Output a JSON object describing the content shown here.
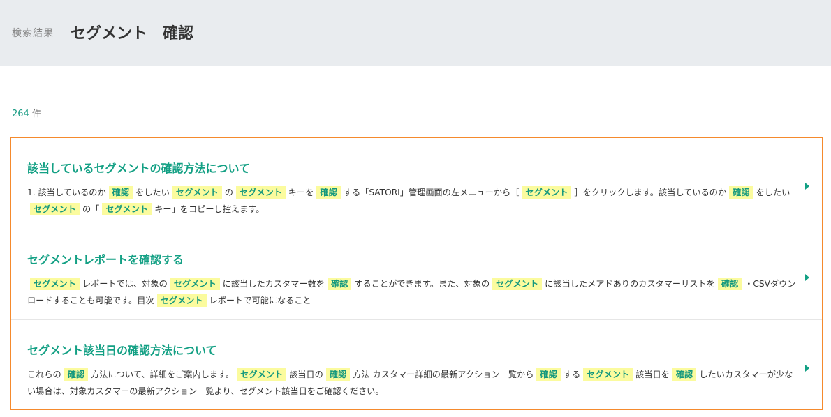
{
  "header": {
    "label": "検索結果",
    "query": "セグメント　確認"
  },
  "result_count": {
    "number": "264",
    "unit": "件"
  },
  "results": [
    {
      "title": "該当しているセグメントの確認方法について",
      "snippet": [
        {
          "t": "1. 該当しているのか"
        },
        {
          "t": "確認",
          "hl": true
        },
        {
          "t": "をしたい"
        },
        {
          "t": "セグメント",
          "hl": true
        },
        {
          "t": "の"
        },
        {
          "t": "セグメント",
          "hl": true
        },
        {
          "t": "キーを"
        },
        {
          "t": "確認",
          "hl": true
        },
        {
          "t": "する「SATORI」管理画面の左メニューから［"
        },
        {
          "t": "セグメント",
          "hl": true
        },
        {
          "t": "］をクリックします。該当しているのか"
        },
        {
          "t": "確認",
          "hl": true
        },
        {
          "t": "をしたい"
        },
        {
          "t": "セグメント",
          "hl": true
        },
        {
          "t": "の「"
        },
        {
          "t": "セグメント",
          "hl": true
        },
        {
          "t": "キー」をコピーし控えます。"
        }
      ]
    },
    {
      "title": "セグメントレポートを確認する",
      "snippet": [
        {
          "t": "セグメント",
          "hl": true
        },
        {
          "t": "レポートでは、対象の"
        },
        {
          "t": "セグメント",
          "hl": true
        },
        {
          "t": "に該当したカスタマー数を"
        },
        {
          "t": "確認",
          "hl": true
        },
        {
          "t": "することができます。また、対象の"
        },
        {
          "t": "セグメント",
          "hl": true
        },
        {
          "t": "に該当したメアドありのカスタマーリストを"
        },
        {
          "t": "確認",
          "hl": true
        },
        {
          "t": "・CSVダウンロードすることも可能です。目次"
        },
        {
          "t": "セグメント",
          "hl": true
        },
        {
          "t": "レポートで可能になること"
        }
      ]
    },
    {
      "title": "セグメント該当日の確認方法について",
      "snippet": [
        {
          "t": "これらの"
        },
        {
          "t": "確認",
          "hl": true
        },
        {
          "t": "方法について、詳細をご案内します。"
        },
        {
          "t": "セグメント",
          "hl": true
        },
        {
          "t": "該当日の"
        },
        {
          "t": "確認",
          "hl": true
        },
        {
          "t": "方法 カスタマー詳細の最新アクション一覧から"
        },
        {
          "t": "確認",
          "hl": true
        },
        {
          "t": "する"
        },
        {
          "t": "セグメント",
          "hl": true
        },
        {
          "t": "該当日を"
        },
        {
          "t": "確認",
          "hl": true
        },
        {
          "t": "したいカスタマーが少ない場合は、対象カスタマーの最新アクション一覧より、セグメント該当日をご確認ください。"
        }
      ]
    }
  ],
  "colors": {
    "accent": "#13a084",
    "highlight_bg": "#fbfb9e",
    "selection_border": "#f58a2d",
    "header_bg": "#e9ecef"
  },
  "icons": {
    "result_arrow": "chevron-right-icon"
  }
}
